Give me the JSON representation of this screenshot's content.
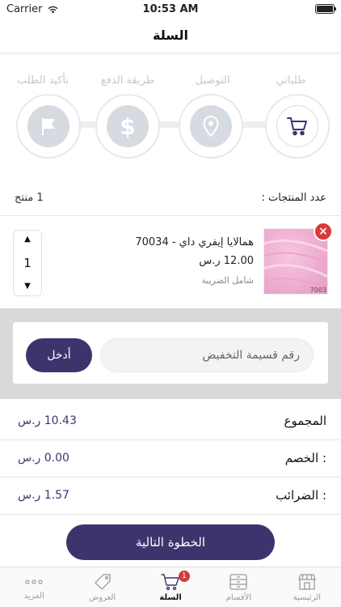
{
  "status_bar": {
    "carrier": "Carrier",
    "time": "10:53 AM"
  },
  "nav": {
    "title": "السلة"
  },
  "steps": [
    {
      "label": "طلباتي",
      "icon": "cart-icon",
      "active": true
    },
    {
      "label": "التوصيل",
      "icon": "location-pin-icon",
      "active": false
    },
    {
      "label": "طريقة الدفع",
      "icon": "dollar-icon",
      "active": false
    },
    {
      "label": "تأكيد الطلب",
      "icon": "flag-icon",
      "active": false
    }
  ],
  "count": {
    "label": "عدد المنتجات :",
    "value": "1 منتج"
  },
  "product": {
    "name": "همالايا إيفري داي - 70034",
    "price": "12.00 ر.س",
    "tax_note": "شامل الضريبة",
    "image_code": "7003",
    "quantity": "1"
  },
  "coupon": {
    "placeholder": "رقم قسيمة التخفيض",
    "button": "أدخل"
  },
  "summary": [
    {
      "label": "المجموع",
      "value": "10.43 ر.س"
    },
    {
      "label": "الخصم :",
      "value": "0.00 ر.س"
    },
    {
      "label": "الضرائب :",
      "value": "1.57 ر.س"
    }
  ],
  "next_button": "الخطوة التالية",
  "tabs": [
    {
      "label": "المزيد",
      "icon": "more-dots-icon"
    },
    {
      "label": "العروض",
      "icon": "tag-icon"
    },
    {
      "label": "السلة",
      "icon": "cart-icon",
      "active": true,
      "badge": "1"
    },
    {
      "label": "الأقسام",
      "icon": "categories-icon"
    },
    {
      "label": "الرئيسية",
      "icon": "store-icon"
    }
  ],
  "colors": {
    "primary": "#3d346e",
    "danger": "#d83a3a",
    "inactive": "#d6dbe1"
  }
}
